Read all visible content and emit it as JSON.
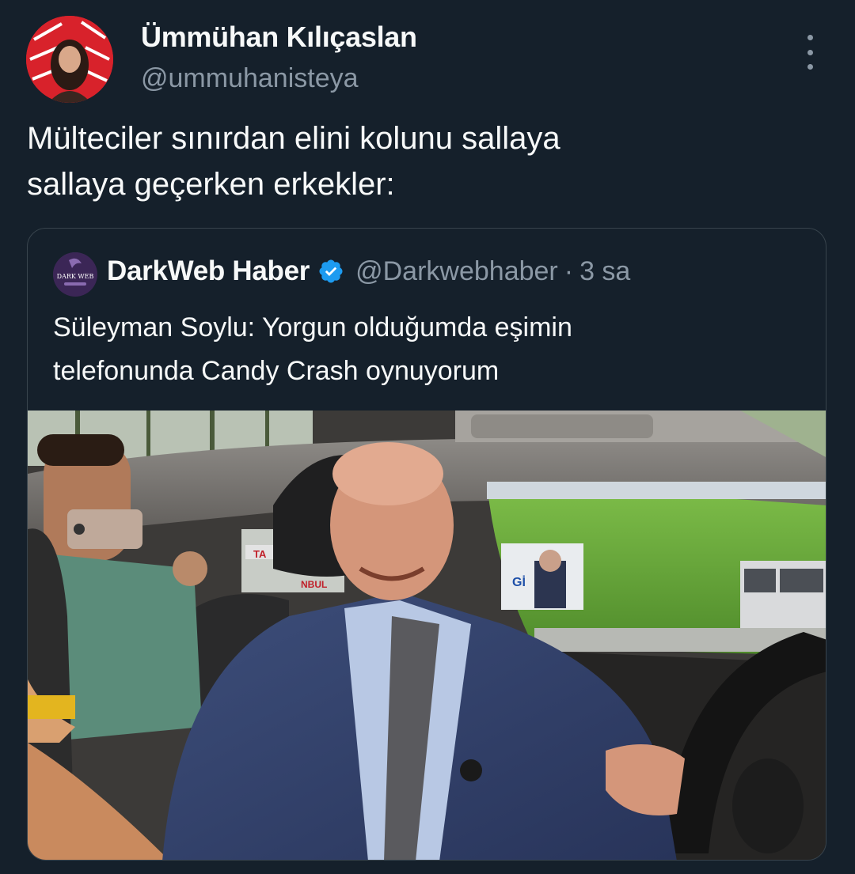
{
  "author": {
    "name": "Ümmühan Kılıçaslan",
    "handle": "@ummuhanisteya"
  },
  "tweet": {
    "text_line1": "Mülteciler sınırdan elini kolunu sallaya",
    "text_line2": "sallaya geçerken erkekler:"
  },
  "quoted": {
    "name": "DarkWeb Haber",
    "handle": "@Darkwebhaber",
    "separator": "·",
    "time": "3 sa",
    "avatar_text": "DARK WEB",
    "text_line1": "Süleyman Soylu: Yorgun olduğumda eşimin",
    "text_line2": "telefonunda Candy Crash oynuyorum",
    "image_signs": {
      "bus_sign_1": "TA",
      "bus_sign_2": "NBUL",
      "billboard_text": "Gİ"
    }
  },
  "icons": {
    "more": "more-vertical-icon",
    "verified": "verified-badge-icon"
  },
  "colors": {
    "background": "#15202b",
    "text_primary": "#f7f9f9",
    "text_secondary": "#8b98a5",
    "border": "#38444d",
    "verified": "#1d9bf0"
  }
}
